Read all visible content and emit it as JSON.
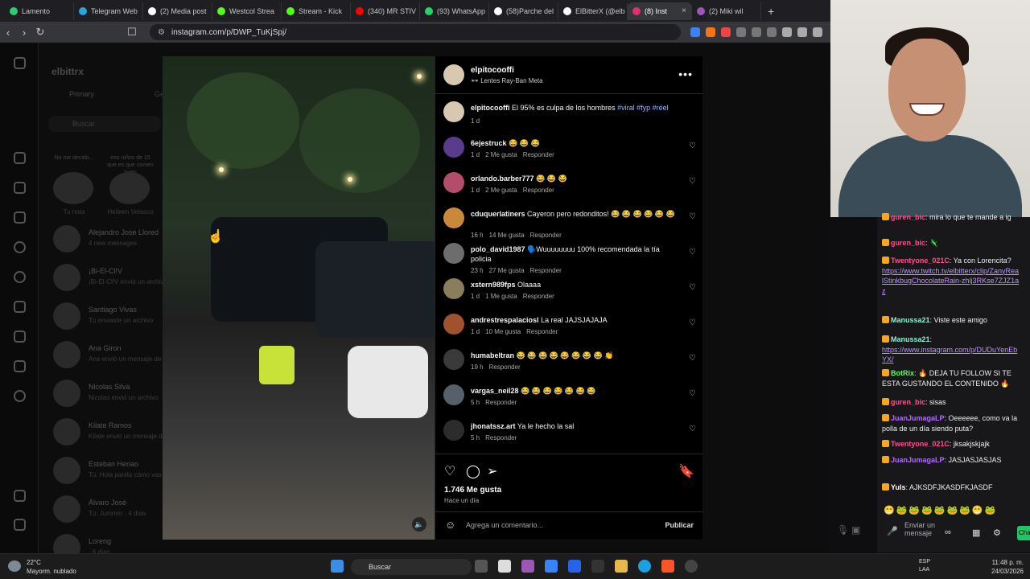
{
  "browser": {
    "tabs": [
      {
        "label": "Lamento",
        "color": "#2ecc71"
      },
      {
        "label": "Telegram Web",
        "color": "#2aa3df"
      },
      {
        "label": "(2) Media post",
        "color": "#ffffff"
      },
      {
        "label": "Westcol Strea",
        "color": "#53fc18"
      },
      {
        "label": "Stream - Kick",
        "color": "#53fc18"
      },
      {
        "label": "(340) MR STIV",
        "color": "#ff0000"
      },
      {
        "label": "(93) WhatsApp",
        "color": "#25d366"
      },
      {
        "label": "(58)Parche del",
        "color": "#ffffff"
      },
      {
        "label": "ElBitterX (@elb",
        "color": "#ffffff"
      },
      {
        "label": "(8) Inst",
        "color": "#e1306c",
        "active": true
      },
      {
        "label": "(2) Miki wil",
        "color": "#9b59b6"
      }
    ],
    "url": "instagram.com/p/DWP_TuKjSpj/"
  },
  "dm": {
    "username": "elbittrx",
    "tab_primary": "Primary",
    "tab_general": "Ge",
    "search": "Buscar",
    "notes": [
      {
        "caption": "No me decido...",
        "name": "Tu nota"
      },
      {
        "caption": "eso niños de 15 que es que comen pues",
        "name": "Heileen Velasco"
      }
    ],
    "conversations": [
      {
        "name": "Alejandro Jose Llored",
        "sub": "4 new messages"
      },
      {
        "name": "¡Bi-El-Cl!V",
        "sub": "¡Bi-El-Cl!V envió un archivo"
      },
      {
        "name": "Santiago Vivas",
        "sub": "Tú enviaste un archivo"
      },
      {
        "name": "Ana Giron",
        "sub": "Ana envió un mensaje de"
      },
      {
        "name": "Nicolas Silva",
        "sub": "Nicolas envió un archivo"
      },
      {
        "name": "Kilate Ramos",
        "sub": "Kilate envió un mensaje d"
      },
      {
        "name": "Esteban Henao",
        "sub": "Tú: Hola panita cómo vas"
      },
      {
        "name": "Álvaro José",
        "sub": "Tú: Jummm · 4 días"
      },
      {
        "name": "Loreng",
        "sub": "· 6 días"
      }
    ]
  },
  "post": {
    "author": "elpitocooffi",
    "device": "Lentes Ray-Ban Meta",
    "caption_user": "elpitocooffi",
    "caption_text": "El 95% es culpa de los hombres",
    "caption_tags": "#viral #fyp #réel",
    "caption_age": "1 d",
    "likes": "1.746 Me gusta",
    "posted": "Hace un día",
    "comment_placeholder": "Agrega un comentario...",
    "publish": "Publicar",
    "comments": [
      {
        "user": "6ejestruck",
        "text": "😂 😂 😂",
        "age": "1 d",
        "likes": "2 Me gusta",
        "reply": "Responder",
        "color": "#5b3b8c"
      },
      {
        "user": "orlando.barber777",
        "text": "😂 😂 😂",
        "age": "1 d",
        "likes": "2 Me gusta",
        "reply": "Responder",
        "color": "#b34d6b"
      },
      {
        "user": "cduquerlatiners",
        "text": "Cayeron pero redonditos! 😂 😂 😂 😂 😂 😂",
        "age": "16 h",
        "likes": "14 Me gusta",
        "reply": "Responder",
        "color": "#c88a3a"
      },
      {
        "user": "polo_david1987",
        "text": "🗣️Wuuuuuuuu 100% recomendada la tía policia",
        "age": "23 h",
        "likes": "27 Me gusta",
        "reply": "Responder",
        "color": "#6d6d6d"
      },
      {
        "user": "xstern989fps",
        "text": "Olaaaa",
        "age": "1 d",
        "likes": "1 Me gusta",
        "reply": "Responder",
        "color": "#8a7d5c"
      },
      {
        "user": "andrestrespalaciosl",
        "text": "La real JAJSJAJAJA",
        "age": "1 d",
        "likes": "10 Me gusta",
        "reply": "Responder",
        "color": "#a0522d"
      },
      {
        "user": "humabeltran",
        "text": "😂 😂 😂 😂 😂 😂 😂 😂 👏",
        "age": "19 h",
        "likes": "",
        "reply": "Responder",
        "color": "#3a3a3a"
      },
      {
        "user": "vargas_neil28",
        "text": "😂 😂 😂 😂 😂 😂 😂",
        "age": "5 h",
        "likes": "",
        "reply": "Responder",
        "color": "#55606a"
      },
      {
        "user": "jhonatssz.art",
        "text": "Ya le hecho la sal",
        "age": "5 h",
        "likes": "",
        "reply": "Responder",
        "color": "#2c2c2c"
      }
    ]
  },
  "chat": {
    "messages": [
      {
        "user": "guren_bic",
        "text": ": mira lo que te mande a ig",
        "ucolor": "#ff4f8b"
      },
      {
        "user": "guren_bic",
        "text": ": 🦎",
        "ucolor": "#ff4f8b"
      },
      {
        "user": "Twentyone_021C",
        "text": ": Ya con Lorencita?",
        "ucolor": "#ff4f8b",
        "link": "https://www.twitch.tv/elbitterx/clip/ZanyRealStinkbugChocolateRain-zhlj3RKse7ZJZ1az"
      },
      {
        "user": "Manussa21",
        "text": ": Viste este amigo",
        "ucolor": "#8bf0d0"
      },
      {
        "user": "Manussa21",
        "text": ":",
        "ucolor": "#8bf0d0",
        "link": "https://www.instagram.com/p/DUDuYenEbYX/"
      },
      {
        "user": "BotRix",
        "text": ": 🔥 DEJA TU FOLLOW SI TE ESTA GUSTANDO EL CONTENIDO 🔥",
        "ucolor": "#5cff5c"
      },
      {
        "user": "guren_bic",
        "text": ": sisas",
        "ucolor": "#ff4f8b"
      },
      {
        "user": "JuanJumagaLP",
        "text": ": Oeeeeee, como va la polla de un día siendo puta?",
        "ucolor": "#b36bff"
      },
      {
        "user": "Twentyone_021C",
        "text": ": jksakjskjajk",
        "ucolor": "#ff4f8b"
      },
      {
        "user": "JuanJumagaLP",
        "text": ": JASJASJASJAS",
        "ucolor": "#b36bff"
      },
      {
        "user": "Yuls",
        "text": ": AJKSDFJKASDFKJASDF",
        "ucolor": "#ffffff"
      }
    ],
    "emotes": "😁🐸🐸🐸🐸🐸🐸😁🐸",
    "send_placeholder": "Enviar un mensaje",
    "chat_button": "Cha"
  },
  "taskbar": {
    "temp": "22°C",
    "weather": "Mayorm. nublado",
    "search": "Buscar",
    "lang1": "ESP",
    "lang2": "LAA",
    "time": "11:48 p. m.",
    "date": "24/03/2026"
  }
}
